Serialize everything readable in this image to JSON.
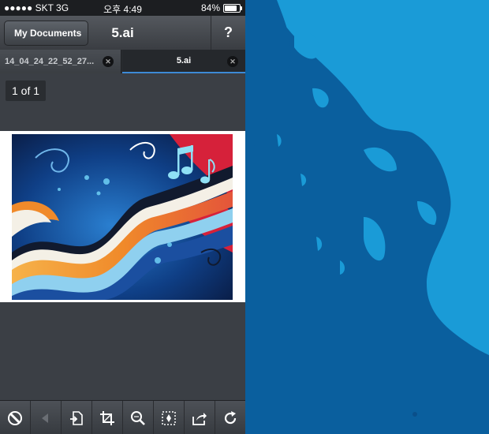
{
  "status_bar": {
    "carrier": "●●●●● SKT  3G",
    "time": "오후 4:49",
    "battery_text": "84%",
    "battery_level": 0.84
  },
  "nav": {
    "back_label": "My Documents",
    "title": "5.ai",
    "help_label": "?"
  },
  "tabs": [
    {
      "label": "14_04_24_22_52_27...",
      "active": false
    },
    {
      "label": "5.ai",
      "active": true
    }
  ],
  "page_counter": "1 of 1",
  "toolbar": {
    "items": [
      {
        "icon": "color-mode-icon"
      },
      {
        "icon": "previous-arrow-icon"
      },
      {
        "icon": "import-page-icon"
      },
      {
        "icon": "crop-icon"
      },
      {
        "icon": "zoom-icon"
      },
      {
        "icon": "fit-selection-icon"
      },
      {
        "icon": "share-icon"
      },
      {
        "icon": "rotate-icon"
      }
    ]
  },
  "colors": {
    "toolbar_bg": "#3b3f45",
    "active_tab_accent": "#3d8ad6",
    "wallpaper_light": "#1a9bd7",
    "wallpaper_dark": "#0a5f9e"
  }
}
